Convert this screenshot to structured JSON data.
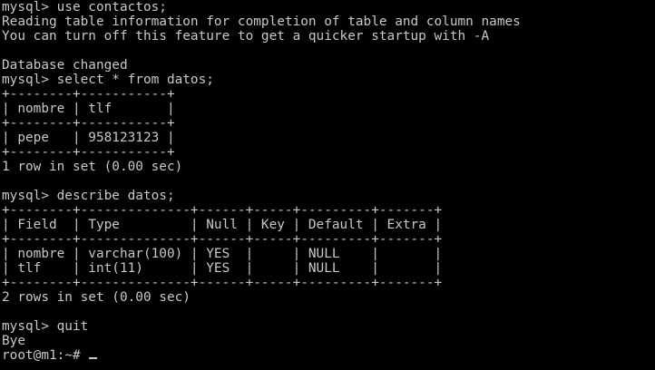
{
  "terminal": {
    "lines": [
      "mysql> use contactos;",
      "Reading table information for completion of table and column names",
      "You can turn off this feature to get a quicker startup with -A",
      "",
      "Database changed",
      "mysql> select * from datos;",
      "+--------+-----------+",
      "| nombre | tlf       |",
      "+--------+-----------+",
      "| pepe   | 958123123 |",
      "+--------+-----------+",
      "1 row in set (0.00 sec)",
      "",
      "mysql> describe datos;",
      "+--------+--------------+------+-----+---------+-------+",
      "| Field  | Type         | Null | Key | Default | Extra |",
      "+--------+--------------+------+-----+---------+-------+",
      "| nombre | varchar(100) | YES  |     | NULL    |       |",
      "| tlf    | int(11)      | YES  |     | NULL    |       |",
      "+--------+--------------+------+-----+---------+-------+",
      "2 rows in set (0.00 sec)",
      "",
      "mysql> quit",
      "Bye",
      "root@m1:~# "
    ],
    "colors": {
      "background": "#000000",
      "foreground": "#c8c8c8"
    }
  }
}
